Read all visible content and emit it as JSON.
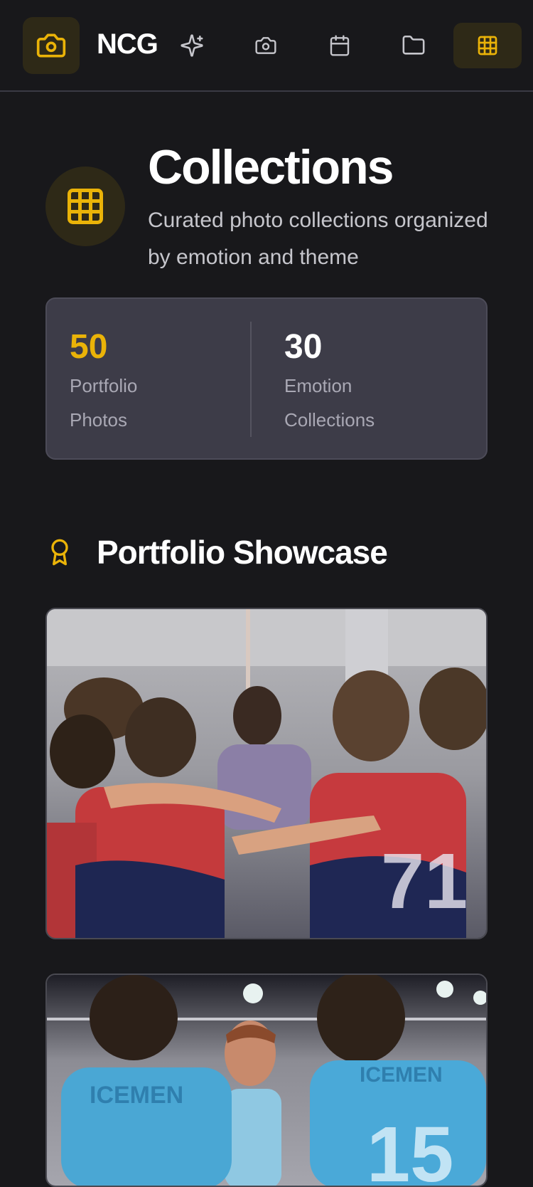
{
  "nav": {
    "brand": "NCG",
    "items": [
      {
        "icon": "sparkles-icon"
      },
      {
        "icon": "camera-icon"
      },
      {
        "icon": "calendar-icon"
      },
      {
        "icon": "folder-icon"
      },
      {
        "icon": "grid-icon",
        "active": true
      }
    ]
  },
  "header": {
    "title": "Collections",
    "subtitle": "Curated photo collections organized by emotion and theme"
  },
  "stats": [
    {
      "value": "50",
      "label": "Portfolio Photos"
    },
    {
      "value": "30",
      "label": "Emotion Collections"
    }
  ],
  "section": {
    "title": "Portfolio Showcase"
  },
  "colors": {
    "accent": "#eab308",
    "background": "#18181b",
    "card": "#3d3c48"
  }
}
